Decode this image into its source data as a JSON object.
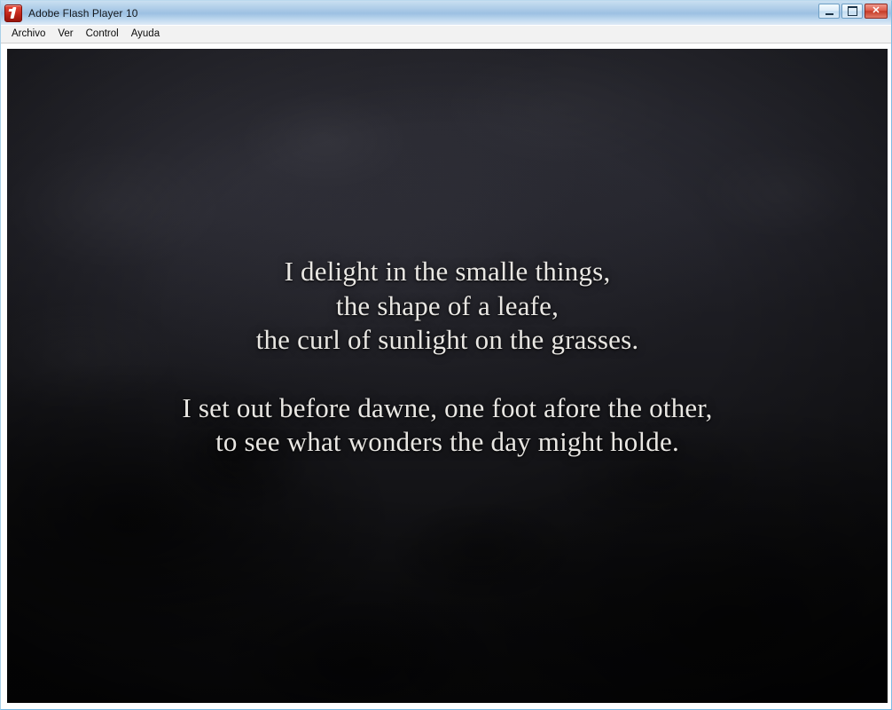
{
  "window": {
    "title": "Adobe Flash Player 10",
    "icon": "flash-player-icon",
    "controls": [
      {
        "name": "minimize-button",
        "label": "—",
        "tooltip": "Minimizar"
      },
      {
        "name": "maximize-button",
        "label": "□",
        "tooltip": "Maximizar"
      },
      {
        "name": "close-button",
        "label": "✕",
        "tooltip": "Cerrar"
      }
    ],
    "colors": {
      "titlebar_top": "#c9dff1",
      "titlebar_bottom": "#dfeaf6",
      "window_border": "#8ec5e8",
      "close_button": "#c53a26",
      "flash_icon_red": "#c1261a",
      "stage_background": "#16161a",
      "poem_text": "#e9e7e3"
    }
  },
  "menu": {
    "items": [
      {
        "name": "menu-archivo",
        "label": "Archivo"
      },
      {
        "name": "menu-ver",
        "label": "Ver"
      },
      {
        "name": "menu-control",
        "label": "Control"
      },
      {
        "name": "menu-ayuda",
        "label": "Ayuda"
      }
    ]
  },
  "stage": {
    "poem": {
      "stanzas": [
        {
          "lines": [
            "I delight in the smalle things,",
            "the shape of a leafe,",
            "the curl of sunlight on the grasses."
          ]
        },
        {
          "lines": [
            "I set out before dawne, one foot afore the other,",
            "to see what wonders the day might holde."
          ]
        }
      ]
    }
  }
}
